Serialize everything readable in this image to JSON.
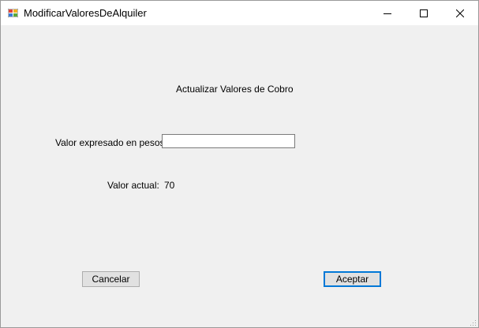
{
  "window": {
    "title": "ModificarValoresDeAlquiler",
    "app_icon": "windows-form-icon",
    "controls": [
      "minimize-icon",
      "maximize-icon",
      "close-icon"
    ]
  },
  "form": {
    "heading": "Actualizar Valores de Cobro",
    "valor_label": "Valor expresado en pesos:",
    "valor_input_value": "",
    "actual_label": "Valor actual:",
    "actual_value": "70"
  },
  "buttons": {
    "cancel_label": "Cancelar",
    "ok_label": "Aceptar"
  },
  "colors": {
    "window_background": "#f0f0f0",
    "titlebar_background": "#ffffff",
    "button_background": "#e1e1e1",
    "default_button_border": "#0078d7"
  }
}
